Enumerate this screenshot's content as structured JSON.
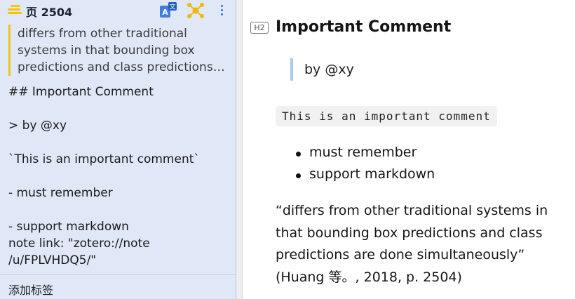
{
  "sidebar": {
    "header": {
      "title": "页 2504",
      "icons": [
        "annotation-highlight-icon",
        "translate-icon",
        "node-graph-icon",
        "more-vertical-icon"
      ]
    },
    "annotation_excerpt": {
      "line1": "differs from other traditional",
      "line2": "systems in that bounding box",
      "line3": "predictions and class predictions are done simultaneously"
    },
    "note_source": {
      "heading_line": "## Important Comment",
      "quote_line": "> by @xy",
      "code_line": "`This is an important comment`",
      "item1_line": "- must remember",
      "item2_line": "- support markdown",
      "link_line1": "note link: \"zotero://note",
      "link_line2": "/u/FPLVHDQ5/\""
    },
    "footer": {
      "add_tags_label": "添加标签"
    },
    "highlight_color": "#f6c400"
  },
  "preview": {
    "heading_level": "H2",
    "heading": "Important Comment",
    "blockquote": "by @xy",
    "code": "This is an important comment",
    "bullets": [
      "must remember",
      "support markdown"
    ],
    "citation": {
      "line1": "“differs from other traditional systems in",
      "line2": "that bounding box predictions and class",
      "line3": "predictions are done simultaneously”",
      "line4": "(Huang 等。, 2018, p. 2504)"
    }
  }
}
